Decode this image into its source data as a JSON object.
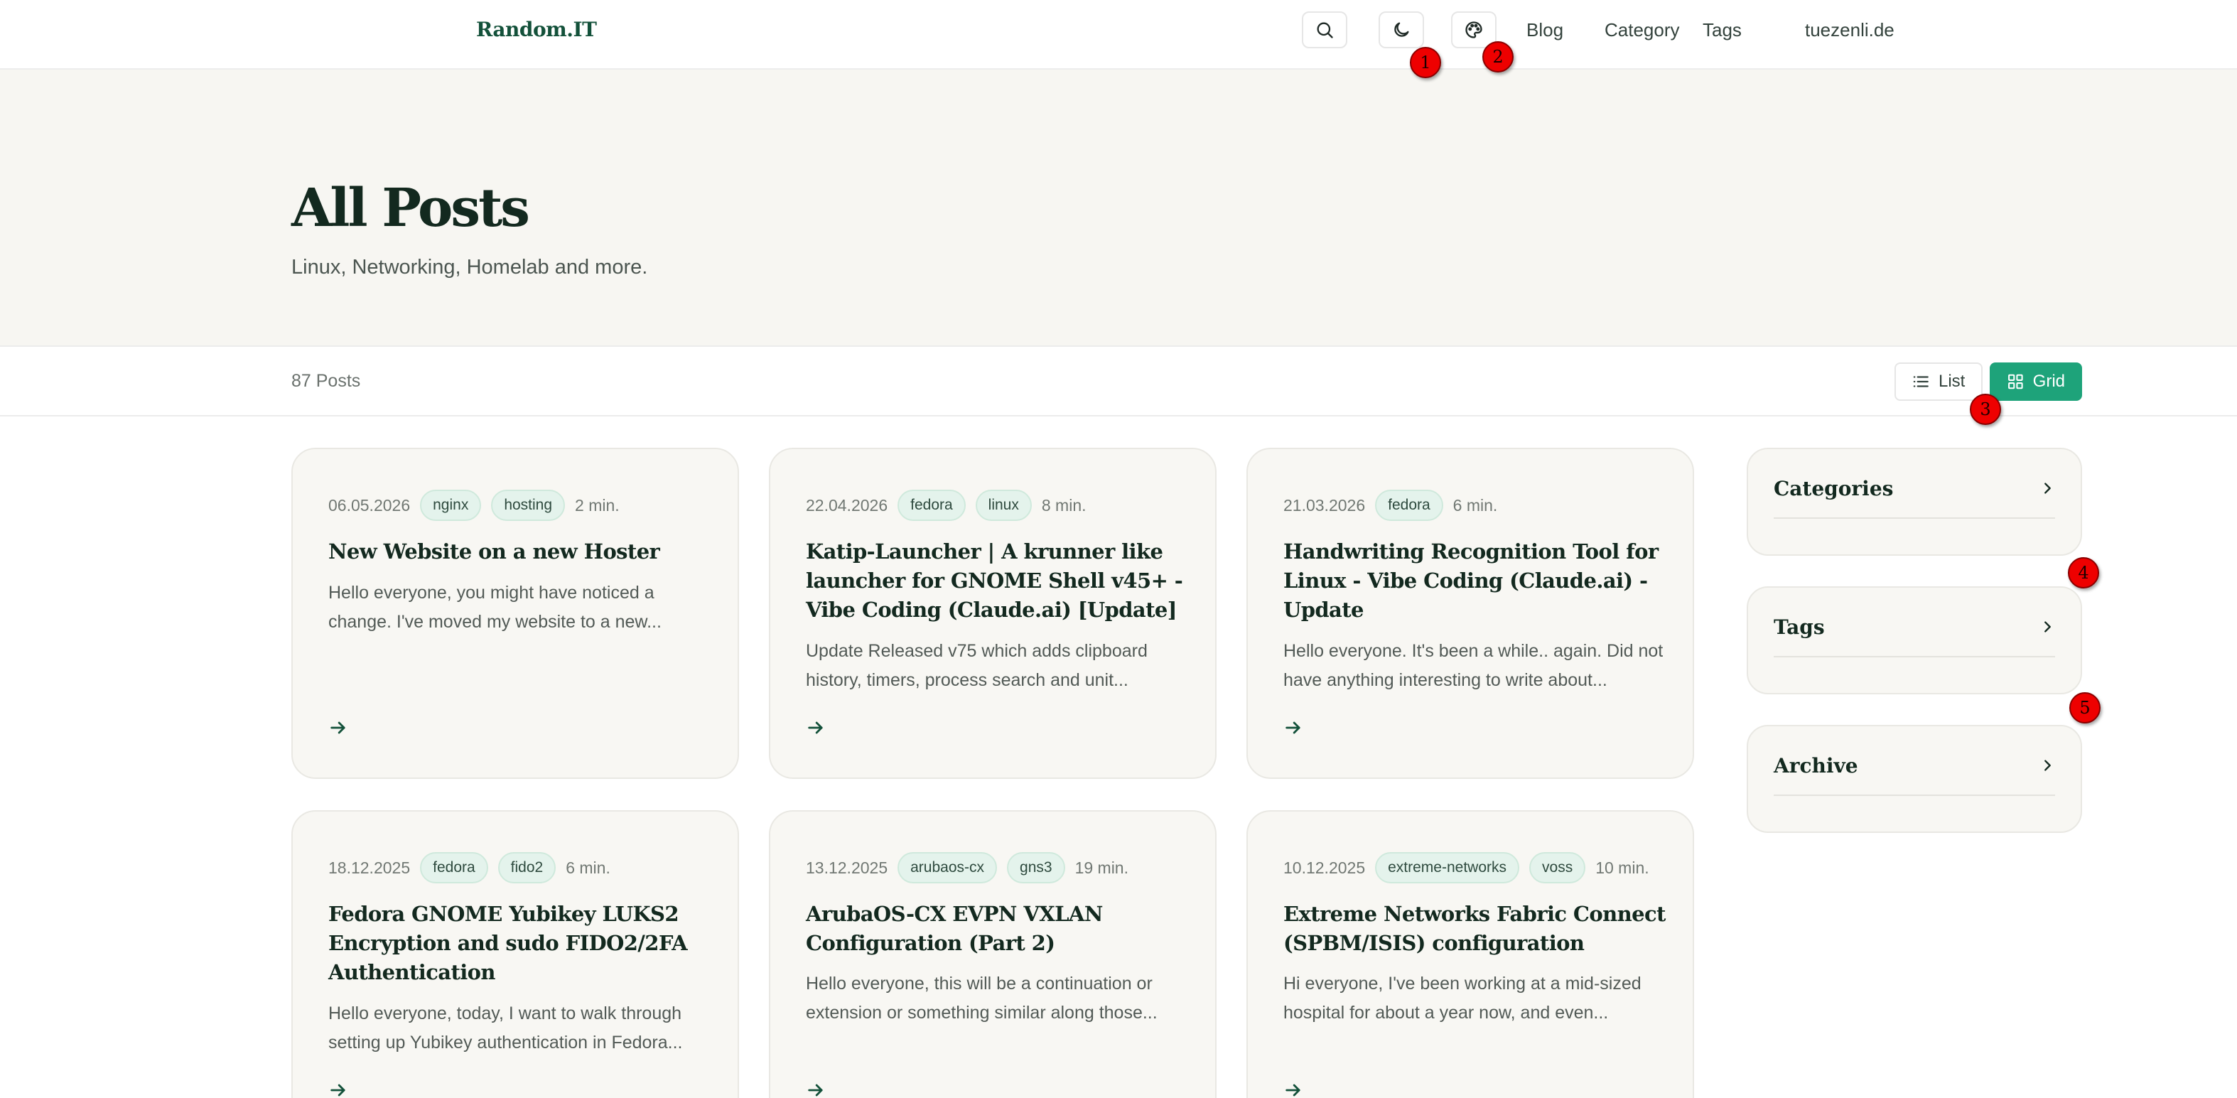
{
  "header": {
    "logo": "Random.IT",
    "icons": [
      "search-icon",
      "moon-icon",
      "palette-icon"
    ],
    "nav": [
      "Blog",
      "Category",
      "Tags",
      "tuezenli.de"
    ]
  },
  "hero": {
    "title": "All Posts",
    "subtitle": "Linux, Networking, Homelab and more."
  },
  "toolbar": {
    "count": "87 Posts",
    "list_label": "List",
    "grid_label": "Grid"
  },
  "posts": [
    {
      "date": "06.05.2026",
      "tags": [
        "nginx",
        "hosting"
      ],
      "read_time": "2 min.",
      "title": "New Website on a new Hoster",
      "excerpt": "Hello everyone, you might have noticed a change. I've moved my website to a new..."
    },
    {
      "date": "22.04.2026",
      "tags": [
        "fedora",
        "linux"
      ],
      "read_time": "8 min.",
      "title": "Katip-Launcher | A krunner like launcher for GNOME Shell v45+ - Vibe Coding (Claude.ai) [Update]",
      "excerpt": "Update Released v75 which adds clipboard history, timers, process search and unit..."
    },
    {
      "date": "21.03.2026",
      "tags": [
        "fedora"
      ],
      "read_time": "6 min.",
      "title": "Handwriting Recognition Tool for Linux - Vibe Coding (Claude.ai) - Update",
      "excerpt": "Hello everyone. It's been a while.. again. Did not have anything interesting to write about..."
    },
    {
      "date": "18.12.2025",
      "tags": [
        "fedora",
        "fido2"
      ],
      "read_time": "6 min.",
      "title": "Fedora GNOME Yubikey LUKS2 Encryption and sudo FIDO2/2FA Authentication",
      "excerpt": "Hello everyone, today, I want to walk through setting up Yubikey authentication in Fedora..."
    },
    {
      "date": "13.12.2025",
      "tags": [
        "arubaos-cx",
        "gns3"
      ],
      "read_time": "19 min.",
      "title": "ArubaOS-CX EVPN VXLAN Configuration (Part 2)",
      "excerpt": "Hello everyone, this will be a continuation or extension or something similar along those..."
    },
    {
      "date": "10.12.2025",
      "tags": [
        "extreme-networks",
        "voss"
      ],
      "read_time": "10 min.",
      "title": "Extreme Networks Fabric Connect (SPBM/ISIS) configuration",
      "excerpt": "Hi everyone, I've been working at a mid-sized hospital for about a year now, and even..."
    }
  ],
  "sidebar": {
    "categories": "Categories",
    "tags": "Tags",
    "archive": "Archive"
  },
  "markers": [
    "1",
    "2",
    "3",
    "4",
    "5"
  ],
  "colors": {
    "accent": "#1ea37a",
    "logo": "#13513a",
    "hero_bg": "#f7f6f2",
    "tag_bg": "#e4f3ec",
    "marker": "#ee0000"
  }
}
